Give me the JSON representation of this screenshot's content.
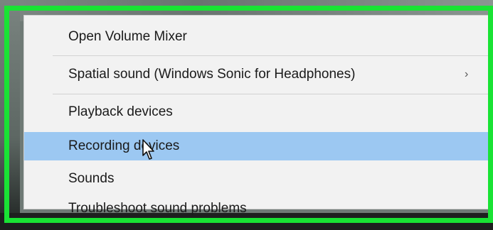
{
  "menu": {
    "items": [
      {
        "label": "Open Volume Mixer"
      },
      {
        "label": "Spatial sound (Windows Sonic for Headphones)",
        "submenu_arrow": "›"
      },
      {
        "label": "Playback devices"
      },
      {
        "label": "Recording devices"
      },
      {
        "label": "Sounds"
      },
      {
        "label": "Troubleshoot sound problems"
      }
    ],
    "highlighted_item": "Recording devices"
  },
  "colors": {
    "frame_highlight": "#19e334",
    "menu_background": "#f2f2f2",
    "hover_background": "#9cc8f2"
  },
  "icons": {
    "cursor": "mouse-pointer-icon",
    "submenu": "chevron-right-icon"
  }
}
